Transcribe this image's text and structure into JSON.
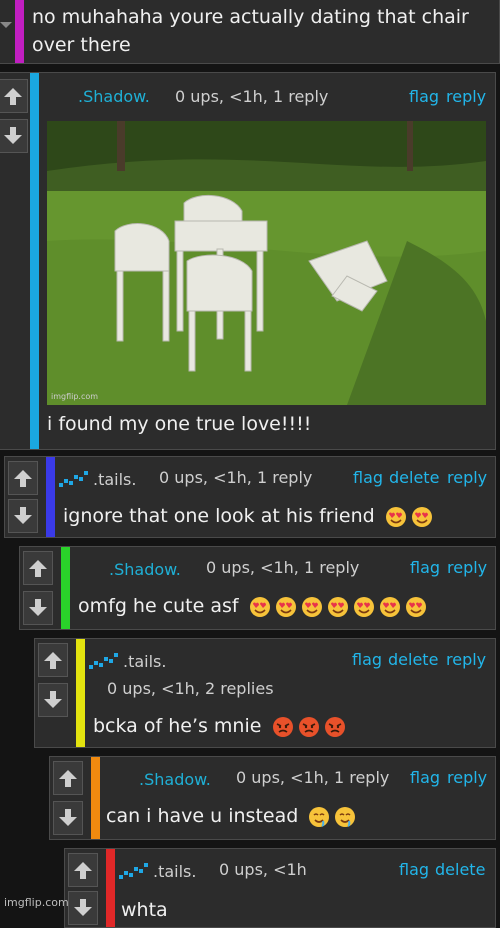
{
  "comments": [
    {
      "body": "no muhahaha youre actually dating that chair over there",
      "accent": "#c21fc2"
    },
    {
      "user": ".Shadow.",
      "meta": "0 ups, <1h, 1 reply",
      "flag": "flag",
      "reply": "reply",
      "body": "i found my one true love!!!!",
      "accent": "#1aa7e0",
      "image_caption": "imgflip.com"
    },
    {
      "user": ".tails.",
      "meta": "0 ups, <1h, 1 reply",
      "flag": "flag",
      "delete": "delete",
      "reply": "reply",
      "body": "ignore that one look at his friend",
      "accent": "#3a3ae8",
      "emoji": "heart-eyes",
      "emoji_count": 2
    },
    {
      "user": ".Shadow.",
      "meta": "0 ups, <1h, 1 reply",
      "flag": "flag",
      "reply": "reply",
      "body": "omfg he cute asf",
      "accent": "#2ad22a",
      "emoji": "heart-eyes",
      "emoji_count": 7
    },
    {
      "user": ".tails.",
      "meta": "0 ups, <1h, 2 replies",
      "flag": "flag",
      "delete": "delete",
      "reply": "reply",
      "body": "bcka of he’s mnie",
      "accent": "#e3e30f",
      "emoji": "angry",
      "emoji_count": 3
    },
    {
      "user": ".Shadow.",
      "meta": "0 ups, <1h, 1 reply",
      "flag": "flag",
      "reply": "reply",
      "body": "can i have u instead",
      "accent": "#f08a0f",
      "emoji": "drooling",
      "emoji_count": 2
    },
    {
      "user": ".tails.",
      "meta": "0 ups, <1h",
      "flag": "flag",
      "delete": "delete",
      "body": "whta",
      "accent": "#e02828"
    }
  ],
  "watermark": "imgflip.com",
  "colors": {
    "link": "#22b6ea",
    "shadow_user": "#1fb0d6",
    "tails_user": "#cfcfcf",
    "badge": "#1fa8e6"
  }
}
